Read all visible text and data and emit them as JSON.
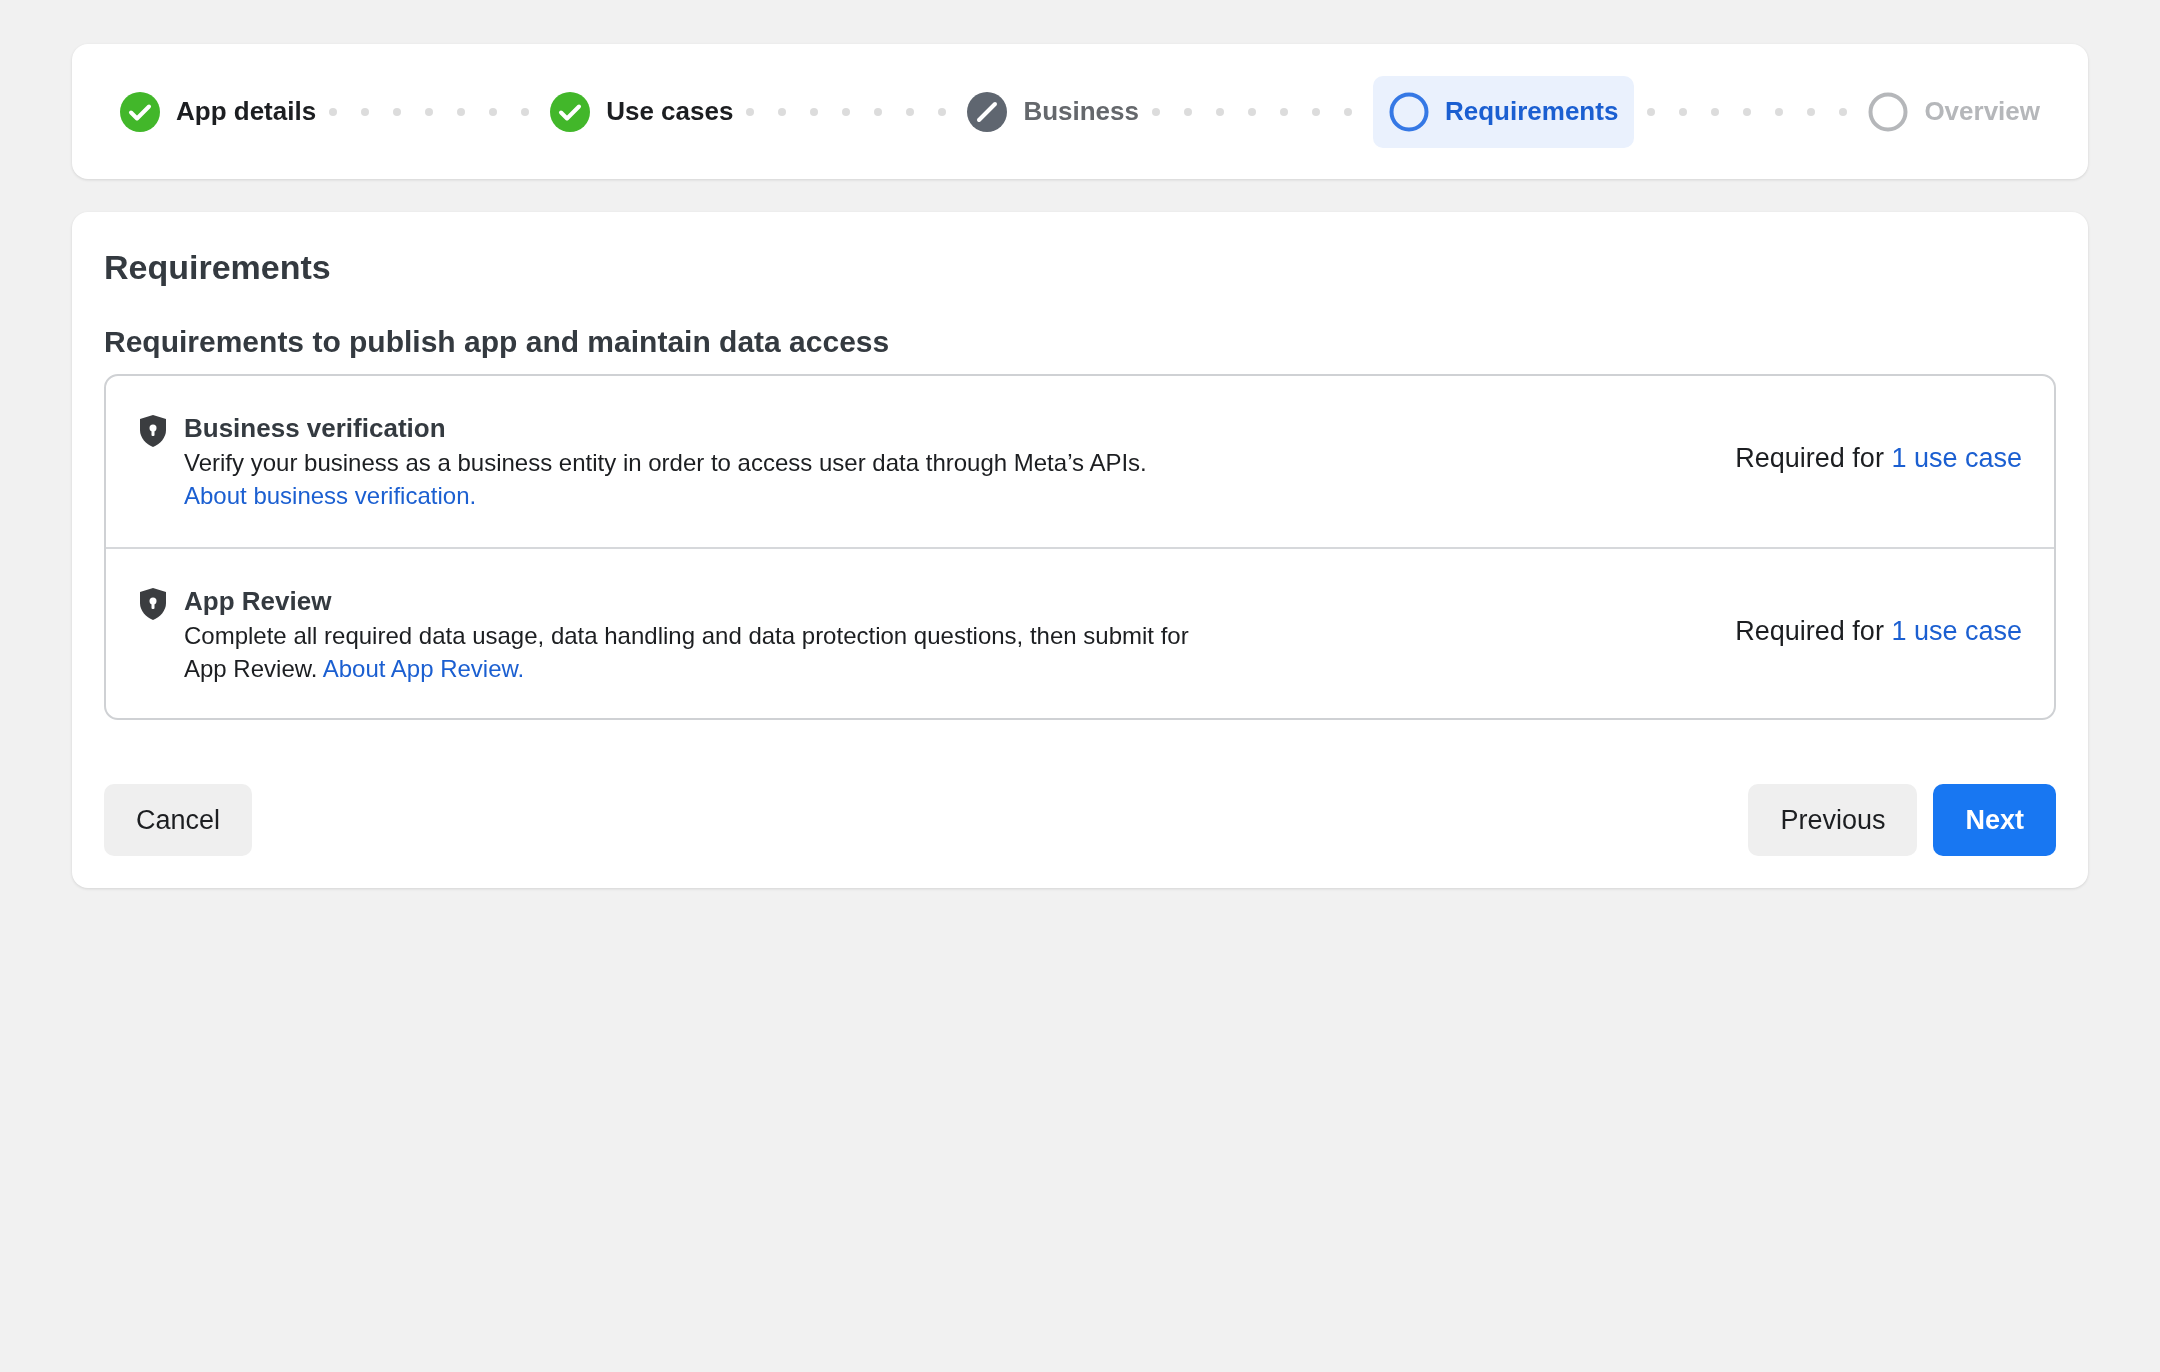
{
  "steps": [
    {
      "label": "App details",
      "kind": "done",
      "selected": false
    },
    {
      "label": "Use cases",
      "kind": "done",
      "selected": false
    },
    {
      "label": "Business",
      "kind": "skipped",
      "selected": false
    },
    {
      "label": "Requirements",
      "kind": "pending",
      "selected": true
    },
    {
      "label": "Overview",
      "kind": "pending",
      "selected": false
    }
  ],
  "title": "Requirements",
  "subtitle": "Requirements to publish app and maintain data access",
  "requirements": [
    {
      "title": "Business verification",
      "description": "Verify your business as a business entity in order to access user data through Meta’s APIs.",
      "link": "About business verification.",
      "required_prefix": "Required for",
      "required_link": "1 use case"
    },
    {
      "title": "App Review",
      "description": "Complete all required data usage, data handling and data protection questions, then submit for App Review.",
      "link": "About App Review.",
      "required_prefix": "Required for",
      "required_link": "1 use case"
    }
  ],
  "buttons": {
    "cancel": "Cancel",
    "previous": "Previous",
    "next": "Next"
  }
}
